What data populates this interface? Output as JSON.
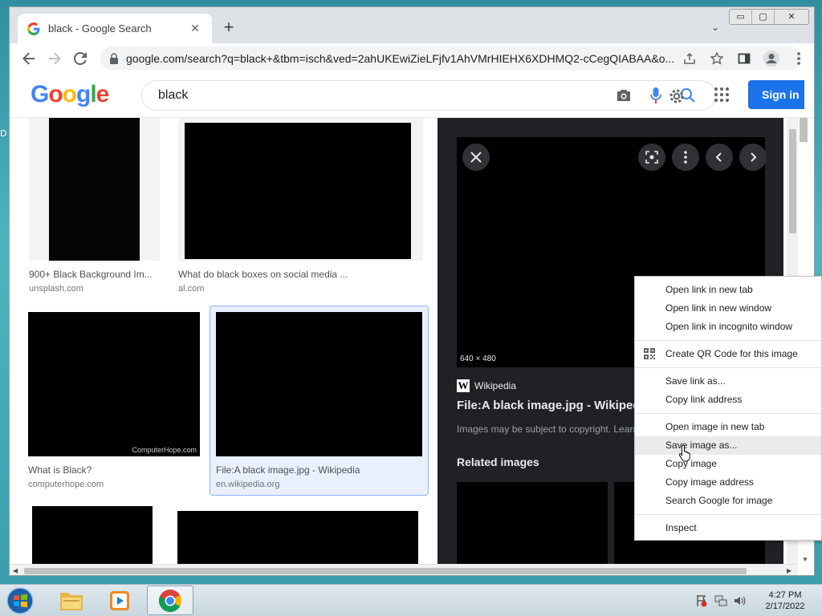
{
  "desktop": {
    "edge_text": "D"
  },
  "browser": {
    "tab": {
      "title": "black - Google Search",
      "close": "✕"
    },
    "new_tab": "+",
    "tab_search": "⌄",
    "window_controls": {
      "minimize": "▭",
      "maximize": "▢",
      "close": "✕"
    },
    "url": "google.com/search?q=black+&tbm=isch&ved=2ahUKEwiZieLFjfv1AhVMrHIEHX6XDHMQ2-cCegQIABAA&o..."
  },
  "google": {
    "logo": [
      "G",
      "o",
      "o",
      "g",
      "l",
      "e"
    ],
    "query": "black",
    "sign_in": "Sign in"
  },
  "results": [
    {
      "caption": "900+ Black Background Im...",
      "source": "unsplash.com"
    },
    {
      "caption": "What do black boxes on social media ...",
      "source": "al.com"
    },
    {
      "caption": "What is Black?",
      "source": "computerhope.com",
      "watermark": "ComputerHope.com"
    },
    {
      "caption": "File:A black image.jpg - Wikipedia",
      "source": "en.wikipedia.org"
    }
  ],
  "preview": {
    "dimensions": "640 × 480",
    "source_logo": "W",
    "source_name": "Wikipedia",
    "title": "File:A black image.jpg - Wikipedia",
    "copyright": "Images may be subject to copyright. Learn More",
    "related_heading": "Related images"
  },
  "context_menu": {
    "groups": [
      [
        "Open link in new tab",
        "Open link in new window",
        "Open link in incognito window"
      ],
      [
        "Create QR Code for this image"
      ],
      [
        "Save link as...",
        "Copy link address"
      ],
      [
        "Open image in new tab",
        "Save image as...",
        "Copy image",
        "Copy image address",
        "Search Google for image"
      ],
      [
        "Inspect"
      ]
    ],
    "highlighted": "Save image as..."
  },
  "taskbar": {
    "clock_time": "4:27 PM",
    "clock_date": "2/17/2022"
  },
  "colors": {
    "accent": "#1a73e8",
    "preview_bg": "#202124",
    "selected_card": "#e8f0fe"
  }
}
